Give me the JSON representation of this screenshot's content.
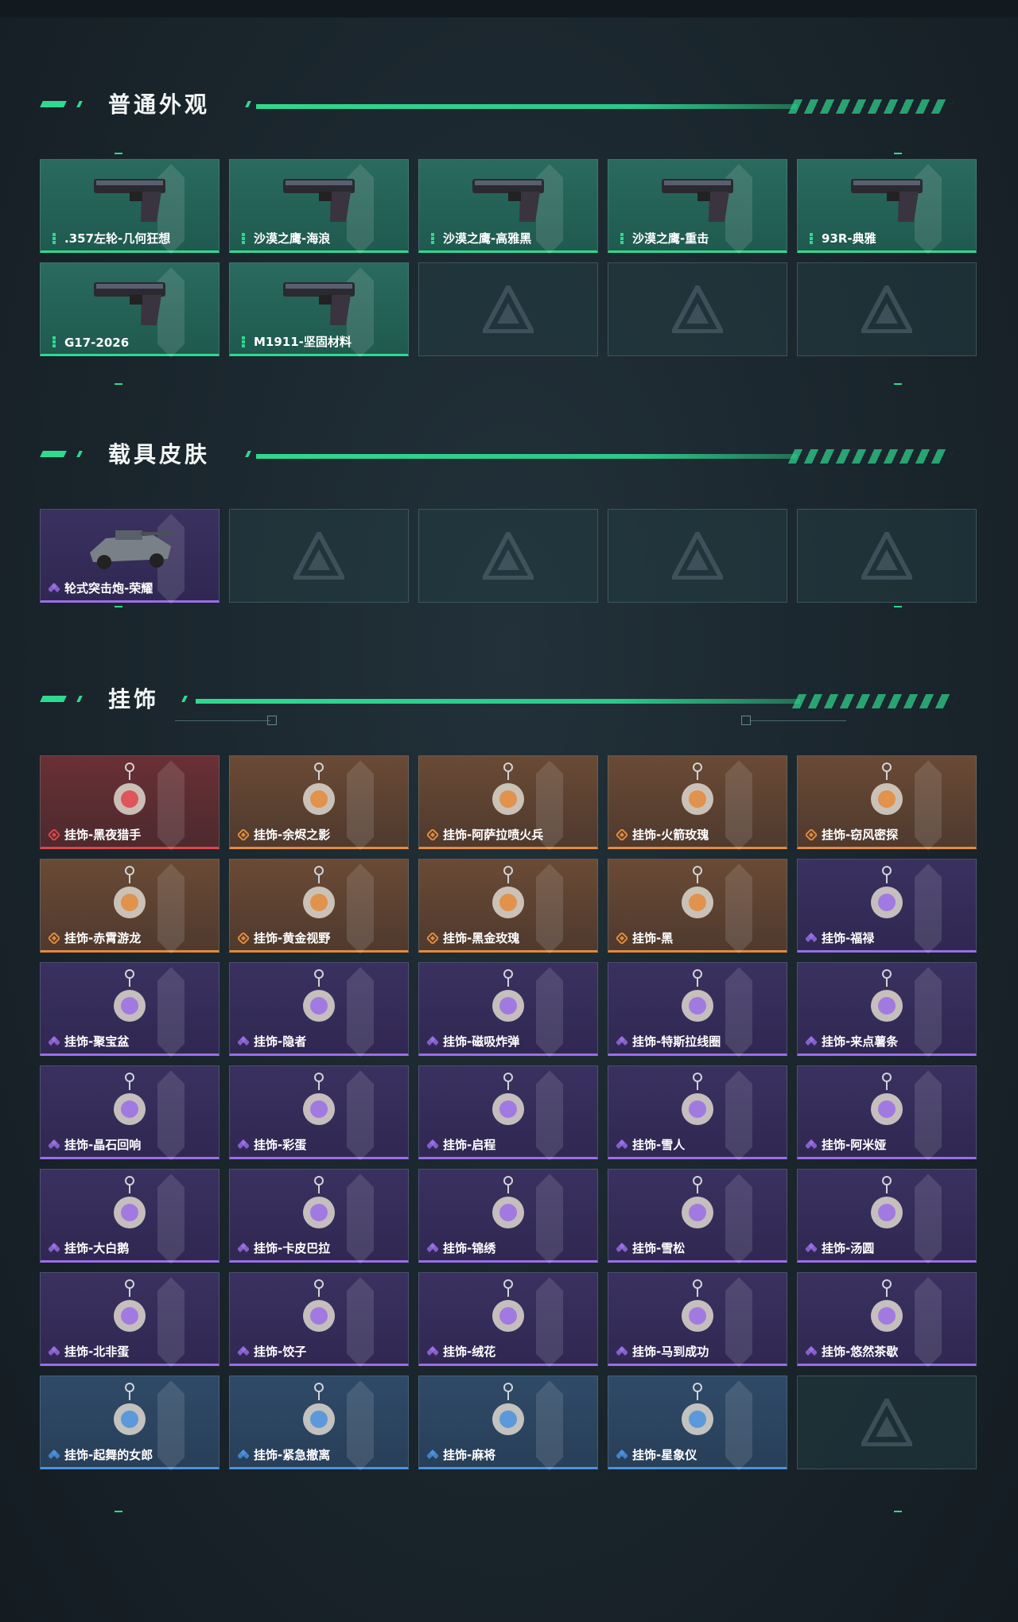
{
  "sections": {
    "weapons": {
      "title": "普通外观"
    },
    "vehicles": {
      "title": "载具皮肤"
    },
    "charms": {
      "title": "挂饰"
    }
  },
  "weapons": [
    {
      "label": ".357左轮-几何狂想",
      "rarity": "normal",
      "icon": "revolver-icon"
    },
    {
      "label": "沙漠之鹰-海浪",
      "rarity": "normal",
      "icon": "pistol-icon"
    },
    {
      "label": "沙漠之鹰-高雅黑",
      "rarity": "normal",
      "icon": "pistol-icon"
    },
    {
      "label": "沙漠之鹰-重击",
      "rarity": "normal",
      "icon": "pistol-icon"
    },
    {
      "label": "93R-典雅",
      "rarity": "normal",
      "icon": "pistol-icon"
    },
    {
      "label": "G17-2026",
      "rarity": "normal",
      "icon": "pistol-icon"
    },
    {
      "label": "M1911-坚固材料",
      "rarity": "normal",
      "icon": "pistol-icon"
    }
  ],
  "vehicles": [
    {
      "label": "轮式突击炮-荣耀",
      "rarity": "purple",
      "icon": "armored-vehicle-icon"
    }
  ],
  "charms": [
    {
      "label": "挂饰-黑夜猎手",
      "rarity": "red"
    },
    {
      "label": "挂饰-余烬之影",
      "rarity": "orange"
    },
    {
      "label": "挂饰-阿萨拉喷火兵",
      "rarity": "orange"
    },
    {
      "label": "挂饰-火箭玫瑰",
      "rarity": "orange"
    },
    {
      "label": "挂饰-窃风密探",
      "rarity": "orange"
    },
    {
      "label": "挂饰-赤霄游龙",
      "rarity": "orange"
    },
    {
      "label": "挂饰-黄金视野",
      "rarity": "orange"
    },
    {
      "label": "挂饰-黑金玫瑰",
      "rarity": "orange"
    },
    {
      "label": "挂饰-黑",
      "rarity": "orange"
    },
    {
      "label": "挂饰-福禄",
      "rarity": "purple"
    },
    {
      "label": "挂饰-聚宝盆",
      "rarity": "purple"
    },
    {
      "label": "挂饰-隐者",
      "rarity": "purple"
    },
    {
      "label": "挂饰-磁吸炸弹",
      "rarity": "purple"
    },
    {
      "label": "挂饰-特斯拉线圈",
      "rarity": "purple"
    },
    {
      "label": "挂饰-来点薯条",
      "rarity": "purple"
    },
    {
      "label": "挂饰-晶石回响",
      "rarity": "purple"
    },
    {
      "label": "挂饰-彩蛋",
      "rarity": "purple"
    },
    {
      "label": "挂饰-启程",
      "rarity": "purple"
    },
    {
      "label": "挂饰-雪人",
      "rarity": "purple"
    },
    {
      "label": "挂饰-阿米娅",
      "rarity": "purple"
    },
    {
      "label": "挂饰-大白鹅",
      "rarity": "purple"
    },
    {
      "label": "挂饰-卡皮巴拉",
      "rarity": "purple"
    },
    {
      "label": "挂饰-锦绣",
      "rarity": "purple"
    },
    {
      "label": "挂饰-雪松",
      "rarity": "purple"
    },
    {
      "label": "挂饰-汤圆",
      "rarity": "purple"
    },
    {
      "label": "挂饰-北非蛋",
      "rarity": "purple"
    },
    {
      "label": "挂饰-饺子",
      "rarity": "purple"
    },
    {
      "label": "挂饰-绒花",
      "rarity": "purple"
    },
    {
      "label": "挂饰-马到成功",
      "rarity": "purple"
    },
    {
      "label": "挂饰-悠然茶歇",
      "rarity": "purple"
    },
    {
      "label": "挂饰-起舞的女郎",
      "rarity": "blue"
    },
    {
      "label": "挂饰-紧急撤离",
      "rarity": "blue"
    },
    {
      "label": "挂饰-麻将",
      "rarity": "blue"
    },
    {
      "label": "挂饰-星象仪",
      "rarity": "blue"
    }
  ],
  "colors": {
    "accent": "#2fd98f",
    "normal": "#2fd98f",
    "purple": "#9a6ee8",
    "orange": "#e58a3a",
    "red": "#e0444a",
    "blue": "#4a92e0"
  }
}
